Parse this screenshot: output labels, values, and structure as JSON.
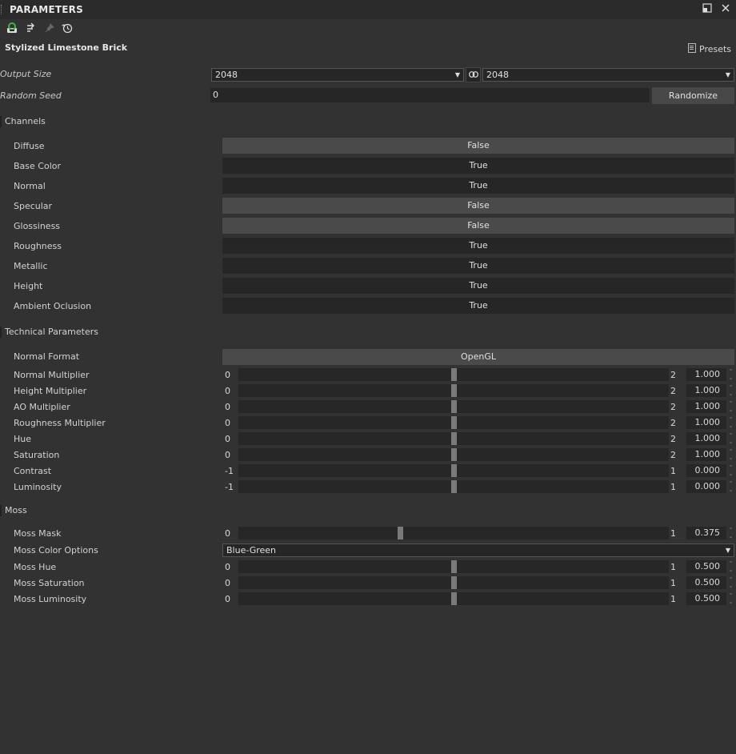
{
  "panel": {
    "title": "PARAMETERS",
    "graph_name": "Stylized Limestone Brick",
    "presets_label": "Presets"
  },
  "toolbar": [
    "save-preset-icon",
    "reset-icon",
    "pin-icon",
    "history-icon"
  ],
  "output_size": {
    "label": "Output Size",
    "width": "2048",
    "height": "2048"
  },
  "random_seed": {
    "label": "Random Seed",
    "value": "0",
    "button": "Randomize"
  },
  "sections": {
    "channels": "Channels",
    "technical": "Technical Parameters",
    "moss": "Moss"
  },
  "channels": [
    {
      "label": "Diffuse",
      "value": "False"
    },
    {
      "label": "Base Color",
      "value": "True"
    },
    {
      "label": "Normal",
      "value": "True"
    },
    {
      "label": "Specular",
      "value": "False"
    },
    {
      "label": "Glossiness",
      "value": "False"
    },
    {
      "label": "Roughness",
      "value": "True"
    },
    {
      "label": "Metallic",
      "value": "True"
    },
    {
      "label": "Height",
      "value": "True"
    },
    {
      "label": "Ambient Oclusion",
      "value": "True"
    }
  ],
  "normal_format": {
    "label": "Normal Format",
    "value": "OpenGL"
  },
  "technical_sliders": [
    {
      "label": "Normal Multiplier",
      "min": "0",
      "max": "2",
      "value": "1.000",
      "fraction": 0.5
    },
    {
      "label": "Height Multiplier",
      "min": "0",
      "max": "2",
      "value": "1.000",
      "fraction": 0.5
    },
    {
      "label": "AO Multiplier",
      "min": "0",
      "max": "2",
      "value": "1.000",
      "fraction": 0.5
    },
    {
      "label": "Roughness Multiplier",
      "min": "0",
      "max": "2",
      "value": "1.000",
      "fraction": 0.5
    },
    {
      "label": "Hue",
      "min": "0",
      "max": "2",
      "value": "1.000",
      "fraction": 0.5
    },
    {
      "label": "Saturation",
      "min": "0",
      "max": "2",
      "value": "1.000",
      "fraction": 0.5
    },
    {
      "label": "Contrast",
      "min": "-1",
      "max": "1",
      "value": "0.000",
      "fraction": 0.5
    },
    {
      "label": "Luminosity",
      "min": "-1",
      "max": "1",
      "value": "0.000",
      "fraction": 0.5
    }
  ],
  "moss_mask": {
    "label": "Moss Mask",
    "min": "0",
    "max": "1",
    "value": "0.375",
    "fraction": 0.375
  },
  "moss_color": {
    "label": "Moss Color Options",
    "value": "Blue-Green"
  },
  "moss_sliders": [
    {
      "label": "Moss Hue",
      "min": "0",
      "max": "1",
      "value": "0.500",
      "fraction": 0.5
    },
    {
      "label": "Moss Saturation",
      "min": "0",
      "max": "1",
      "value": "0.500",
      "fraction": 0.5
    },
    {
      "label": "Moss Luminosity",
      "min": "0",
      "max": "1",
      "value": "0.500",
      "fraction": 0.5
    }
  ]
}
